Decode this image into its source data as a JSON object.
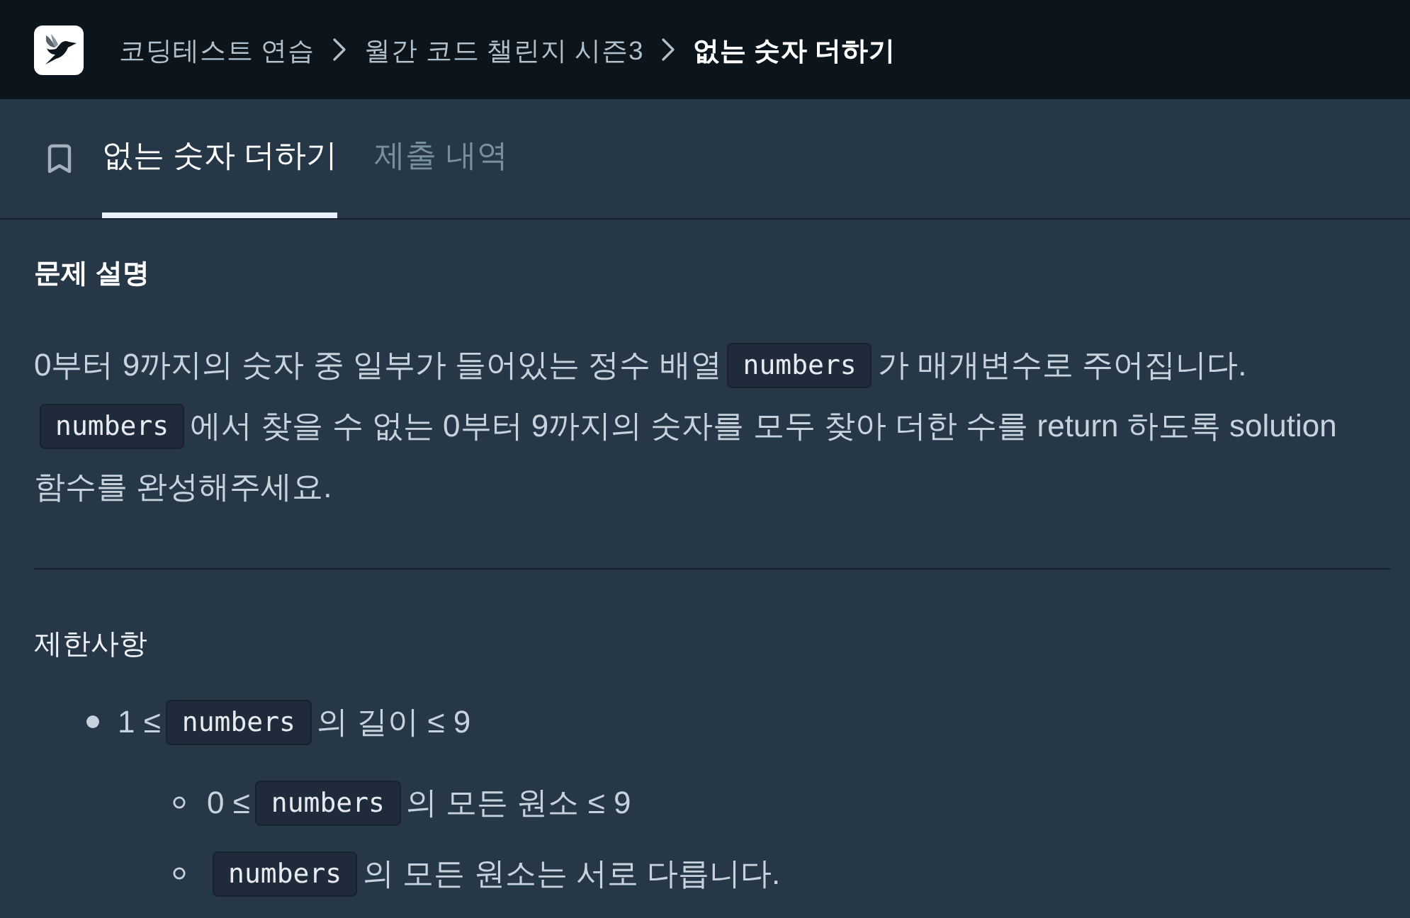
{
  "header": {
    "breadcrumbs": [
      {
        "label": "코딩테스트 연습",
        "current": false
      },
      {
        "label": "월간 코드 챌린지 시즌3",
        "current": false
      },
      {
        "label": "없는 숫자 더하기",
        "current": true
      }
    ]
  },
  "tabs": [
    {
      "label": "없는 숫자 더하기",
      "selected": true
    },
    {
      "label": "제출 내역",
      "selected": false
    }
  ],
  "description": {
    "title": "문제 설명",
    "paragraph": [
      {
        "kind": "text",
        "text": "0부터 9까지의 숫자 중 일부가 들어있는 정수 배열"
      },
      {
        "kind": "code",
        "text": "numbers"
      },
      {
        "kind": "text",
        "text": "가 매개변수로 주어집니다."
      },
      {
        "kind": "code",
        "text": "numbers"
      },
      {
        "kind": "text",
        "text": "에서 찾을 수 없는 0부터 9까지의 숫자를 모두 찾아 더한 수를 return 하도록 solution 함수를 완성해주세요."
      }
    ]
  },
  "constraints": {
    "title": "제한사항",
    "items": [
      {
        "segments": [
          {
            "kind": "text",
            "text": "1 ≤"
          },
          {
            "kind": "code",
            "text": "numbers"
          },
          {
            "kind": "text",
            "text": "의 길이 ≤ 9"
          }
        ],
        "children": [
          {
            "segments": [
              {
                "kind": "text",
                "text": "0 ≤"
              },
              {
                "kind": "code",
                "text": "numbers"
              },
              {
                "kind": "text",
                "text": "의 모든 원소 ≤ 9"
              }
            ]
          },
          {
            "segments": [
              {
                "kind": "code",
                "text": "numbers"
              },
              {
                "kind": "text",
                "text": "의 모든 원소는 서로 다릅니다."
              }
            ]
          }
        ]
      }
    ]
  }
}
